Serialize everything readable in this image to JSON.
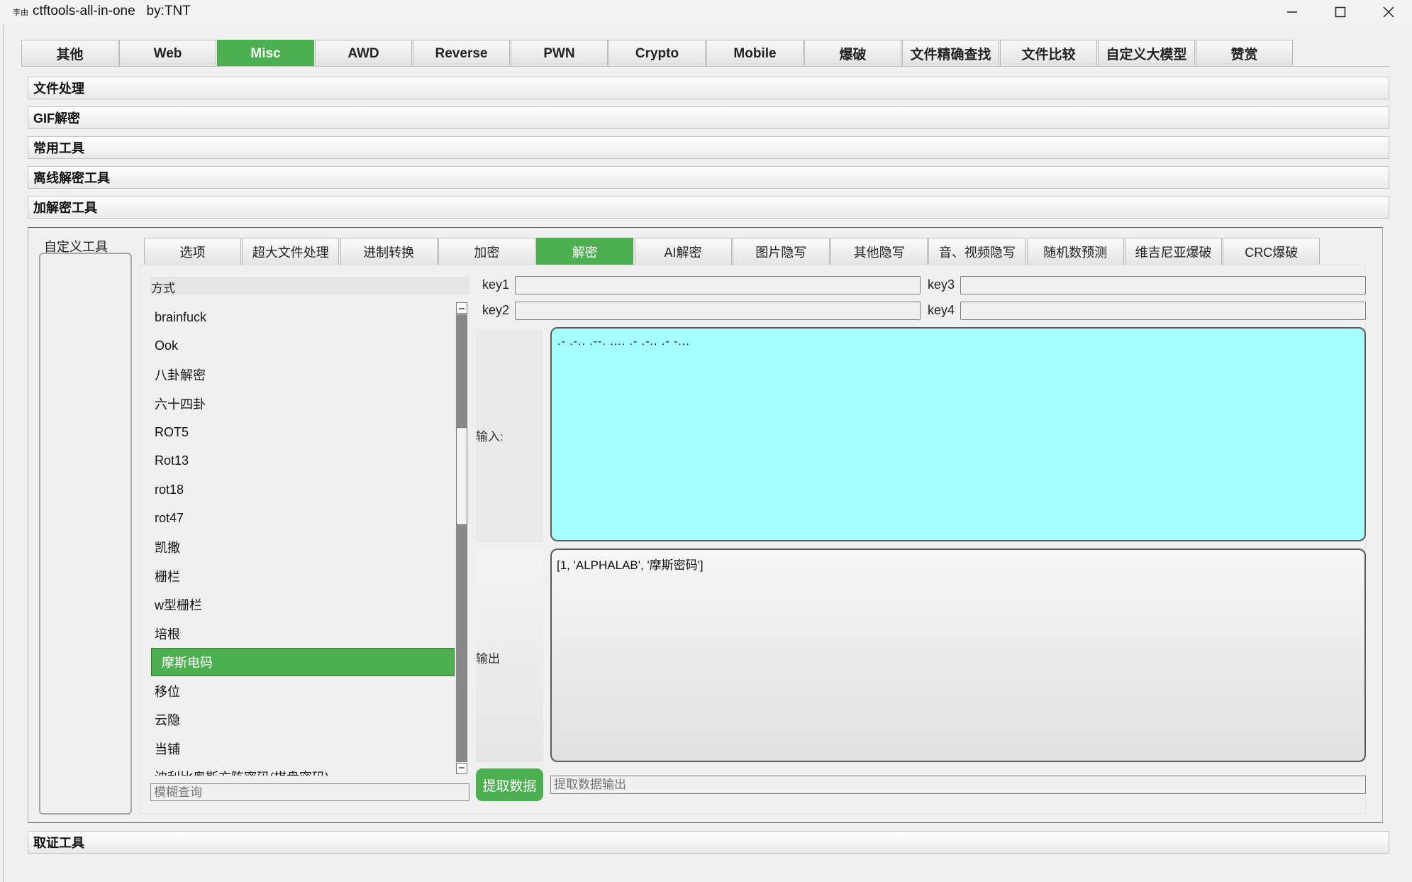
{
  "window": {
    "icon_text": "李由",
    "title": "ctftools-all-in-one   by:TNT"
  },
  "top_tabs": [
    "其他",
    "Web",
    "Misc",
    "AWD",
    "Reverse",
    "PWN",
    "Crypto",
    "Mobile",
    "爆破",
    "文件精确查找",
    "文件比较",
    "自定义大模型",
    "赞赏"
  ],
  "top_tab_active": "Misc",
  "sections": [
    "文件处理",
    "GIF解密",
    "常用工具",
    "离线解密工具",
    "加解密工具"
  ],
  "custom_tools_label": "自定义工具",
  "sub_tabs": [
    "选项",
    "超大文件处理",
    "进制转换",
    "加密",
    "解密",
    "AI解密",
    "图片隐写",
    "其他隐写",
    "音、视频隐写",
    "随机数预测",
    "维吉尼亚爆破",
    "CRC爆破"
  ],
  "sub_tab_active": "解密",
  "methods": {
    "header": "方式",
    "items": [
      "brainfuck",
      "Ook",
      "八卦解密",
      "六十四卦",
      "ROT5",
      "Rot13",
      "rot18",
      "rot47",
      "凯撒",
      "栅栏",
      "w型栅栏",
      "培根",
      "摩斯电码",
      "移位",
      "云隐",
      "当铺",
      "波利比奥斯方阵密码(棋盘密码)"
    ],
    "selected": "摩斯电码",
    "search_placeholder": "模糊查询"
  },
  "keys": {
    "key1": {
      "label": "key1",
      "value": ""
    },
    "key2": {
      "label": "key2",
      "value": ""
    },
    "key3": {
      "label": "key3",
      "value": ""
    },
    "key4": {
      "label": "key4",
      "value": ""
    }
  },
  "io": {
    "input_label": "输入:",
    "input_value": ".- .-.. .--. .... .- .-.. .- -...",
    "output_label": "输出",
    "output_value": "[1, 'ALPHALAB', '摩斯密码']",
    "extract_button": "提取数据",
    "extract_placeholder": "提取数据输出"
  },
  "footer_section": "取证工具",
  "colors": {
    "accent": "#4caf50",
    "input_bg": "#a6ffff"
  }
}
